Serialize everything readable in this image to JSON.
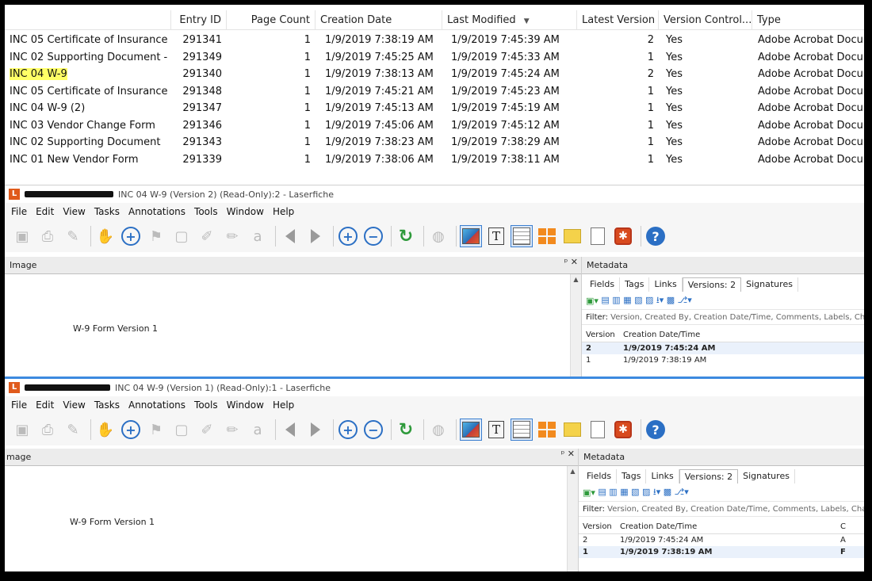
{
  "list": {
    "headers": [
      "Entry ID",
      "Page Count",
      "Creation Date",
      "Last Modified",
      "Latest Version",
      "Version Control...",
      "Type"
    ],
    "rows": [
      {
        "name": "INC 05 Certificate of Insurance",
        "id": "291341",
        "pages": "1",
        "created": "1/9/2019 7:38:19 AM",
        "modified": "1/9/2019 7:45:39 AM",
        "version": "2",
        "vc": "Yes",
        "type": "Adobe Acrobat Docu"
      },
      {
        "name": "INC 02 Supporting Document -...",
        "id": "291349",
        "pages": "1",
        "created": "1/9/2019 7:45:25 AM",
        "modified": "1/9/2019 7:45:33 AM",
        "version": "1",
        "vc": "Yes",
        "type": "Adobe Acrobat Docu"
      },
      {
        "name": "INC 04 W-9",
        "id": "291340",
        "pages": "1",
        "created": "1/9/2019 7:38:13 AM",
        "modified": "1/9/2019 7:45:24 AM",
        "version": "2",
        "vc": "Yes",
        "type": "Adobe Acrobat Docu"
      },
      {
        "name": "INC 05 Certificate of Insurance ...",
        "id": "291348",
        "pages": "1",
        "created": "1/9/2019 7:45:21 AM",
        "modified": "1/9/2019 7:45:23 AM",
        "version": "1",
        "vc": "Yes",
        "type": "Adobe Acrobat Docu"
      },
      {
        "name": "INC 04 W-9 (2)",
        "id": "291347",
        "pages": "1",
        "created": "1/9/2019 7:45:13 AM",
        "modified": "1/9/2019 7:45:19 AM",
        "version": "1",
        "vc": "Yes",
        "type": "Adobe Acrobat Docu"
      },
      {
        "name": "INC 03 Vendor Change Form",
        "id": "291346",
        "pages": "1",
        "created": "1/9/2019 7:45:06 AM",
        "modified": "1/9/2019 7:45:12 AM",
        "version": "1",
        "vc": "Yes",
        "type": "Adobe Acrobat Docu"
      },
      {
        "name": "INC 02 Supporting Document",
        "id": "291343",
        "pages": "1",
        "created": "1/9/2019 7:38:23 AM",
        "modified": "1/9/2019 7:38:29 AM",
        "version": "1",
        "vc": "Yes",
        "type": "Adobe Acrobat Docu"
      },
      {
        "name": "INC 01 New Vendor Form",
        "id": "291339",
        "pages": "1",
        "created": "1/9/2019 7:38:06 AM",
        "modified": "1/9/2019 7:38:11 AM",
        "version": "1",
        "vc": "Yes",
        "type": "Adobe Acrobat Docu"
      }
    ],
    "highlight_color": "#ffff66"
  },
  "menu": [
    "File",
    "Edit",
    "View",
    "Tasks",
    "Annotations",
    "Tools",
    "Window",
    "Help"
  ],
  "accent_color": "#3c8adf",
  "window1": {
    "title": "INC 04 W-9 (Version 2) (Read-Only):2 - Laserfiche",
    "image_pane_title": "Image",
    "pane_controls": "4 ×",
    "doc_text": "W-9 Form Version 1",
    "metadata_title": "Metadata",
    "tabs": [
      "Fields",
      "Tags",
      "Links",
      "Versions: 2",
      "Signatures"
    ],
    "filter_label": "Filter:",
    "filter_text": "Version, Created By, Creation Date/Time, Comments, Labels, Ch",
    "vt_headers": [
      "Version",
      "Creation Date/Time"
    ],
    "vt_rows": [
      {
        "v": "2",
        "d": "1/9/2019 7:45:24 AM"
      },
      {
        "v": "1",
        "d": "1/9/2019 7:38:19 AM"
      }
    ]
  },
  "window2": {
    "title": "INC 04 W-9 (Version 1) (Read-Only):1 - Laserfiche",
    "image_pane_title": "mage",
    "doc_text": "W-9 Form Version 1",
    "metadata_title": "Metadata",
    "tabs": [
      "Fields",
      "Tags",
      "Links",
      "Versions: 2",
      "Signatures"
    ],
    "filter_label": "Filter:",
    "filter_text": "Version, Created By, Creation Date/Time, Comments, Labels, Cha",
    "vt_headers": [
      "Version",
      "Creation Date/Time",
      "C"
    ],
    "vt_rows": [
      {
        "v": "2",
        "d": "1/9/2019 7:45:24 AM",
        "x": "A"
      },
      {
        "v": "1",
        "d": "1/9/2019 7:38:19 AM",
        "x": "F"
      }
    ]
  }
}
